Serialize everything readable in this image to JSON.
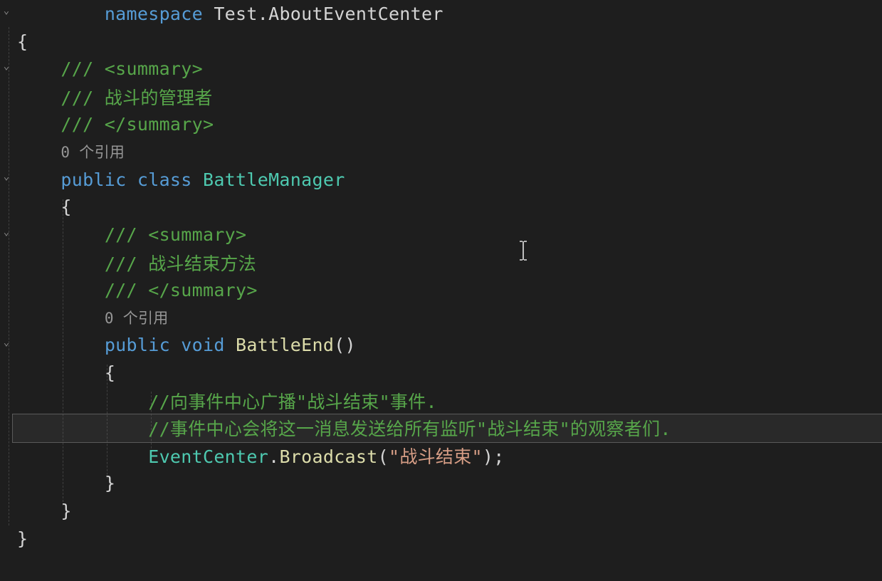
{
  "code": {
    "namespace_kw": "namespace",
    "namespace_name": " Test.AboutEventCenter",
    "open_brace_ns": "{",
    "xml_summary_open": "/// <summary>",
    "xml_class_desc": "/// 战斗的管理者",
    "xml_summary_close": "/// </summary>",
    "codelens_class": "0 个引用",
    "public_kw": "public",
    "class_kw": " class",
    "class_name": " BattleManager",
    "open_brace_cls": "{",
    "xml_summary_open2": "/// <summary>",
    "xml_method_desc": "/// 战斗结束方法",
    "xml_summary_close2": "/// </summary>",
    "codelens_method": "0 个引用",
    "void_kw": " void",
    "method_name": " BattleEnd",
    "parens": "()",
    "open_brace_m": "{",
    "comment1": "//向事件中心广播\"战斗结束\"事件.",
    "comment2": "//事件中心会将这一消息发送给所有监听\"战斗结束\"的观察者们.",
    "call_type": "EventCenter",
    "call_dot": ".",
    "call_method": "Broadcast",
    "call_open": "(",
    "call_str": "\"战斗结束\"",
    "call_close": ");",
    "close_brace_m": "}",
    "close_brace_cls": "}",
    "close_brace_ns": "}"
  },
  "fold_glyph": "⌄"
}
